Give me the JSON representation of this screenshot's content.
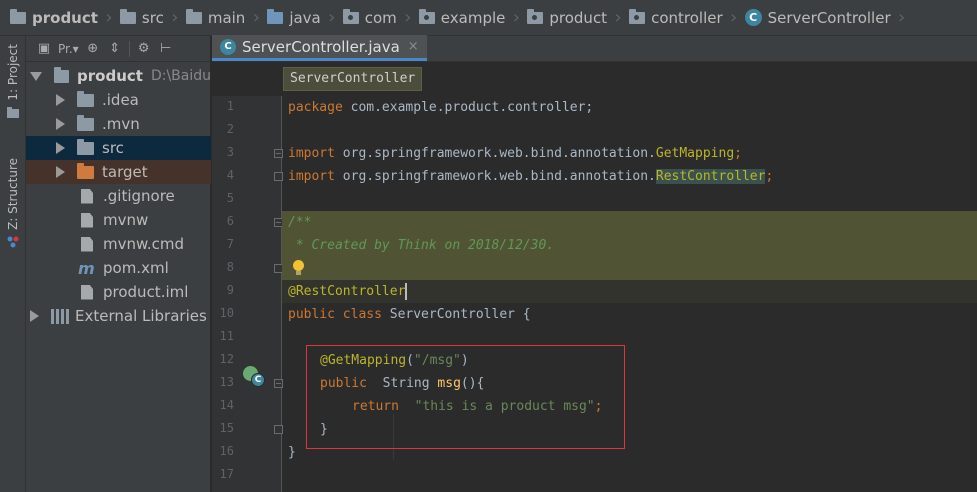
{
  "breadcrumb": [
    "product",
    "src",
    "main",
    "java",
    "com",
    "example",
    "product",
    "controller",
    "ServerController"
  ],
  "left_stripe": {
    "project_tab": "1: Project",
    "structure_tab": "Z: Structure"
  },
  "project_toolbar": {
    "view_label": "Pr.▾"
  },
  "tree": [
    {
      "label": "product",
      "hint": "D:\\Baidu",
      "icon": "project-folder-icon",
      "expanded": true
    },
    {
      "label": ".idea",
      "icon": "folder-icon"
    },
    {
      "label": ".mvn",
      "icon": "folder-icon"
    },
    {
      "label": "src",
      "icon": "source-folder-icon",
      "selected": true
    },
    {
      "label": "target",
      "icon": "excluded-folder-icon"
    },
    {
      "label": ".gitignore",
      "icon": "file-icon"
    },
    {
      "label": "mvnw",
      "icon": "file-icon"
    },
    {
      "label": "mvnw.cmd",
      "icon": "file-icon"
    },
    {
      "label": "pom.xml",
      "icon": "maven-icon"
    },
    {
      "label": "product.iml",
      "icon": "file-icon"
    },
    {
      "label": "External Libraries",
      "icon": "library-icon"
    }
  ],
  "editor": {
    "tab_label": "ServerController.java",
    "tab_close": "×",
    "popup_label": "ServerController",
    "line_numbers": [
      "1",
      "2",
      "3",
      "4",
      "5",
      "6",
      "7",
      "8",
      "9",
      "10",
      "11",
      "12",
      "13",
      "14",
      "15",
      "16",
      "17"
    ],
    "lines": {
      "l1_kw": "package",
      "l1_rest": " com.example.product.controller;",
      "l3_kw": "import",
      "l3_rest": " org.springframework.web.bind.annotation.",
      "l3_ann": "GetMapping",
      "l3_end": ";",
      "l4_kw": "import",
      "l4_rest": " org.springframework.web.bind.annotation.",
      "l4_ann": "RestController",
      "l4_end": ";",
      "l6": "/**",
      "l7": " * Created by Think on 2018/12/30.",
      "l9": "@RestController",
      "l10_kw": "public class",
      "l10_rest": " ServerController {",
      "l12_ann": "@GetMapping",
      "l12_p1": "(",
      "l12_str": "\"/msg\"",
      "l12_p2": ")",
      "l13_kw": "public",
      "l13_type": "  String ",
      "l13_fn": "msg",
      "l13_rest": "(){",
      "l14_kw": "return",
      "l14_str": "  \"this is a product msg\"",
      "l14_end": ";",
      "l15": "}",
      "l16": "}"
    }
  },
  "colors": {
    "keyword": "#cc7832",
    "annotation": "#bbb529",
    "string": "#6a8759",
    "comment": "#629755",
    "highlight_box": "#d9363e"
  }
}
